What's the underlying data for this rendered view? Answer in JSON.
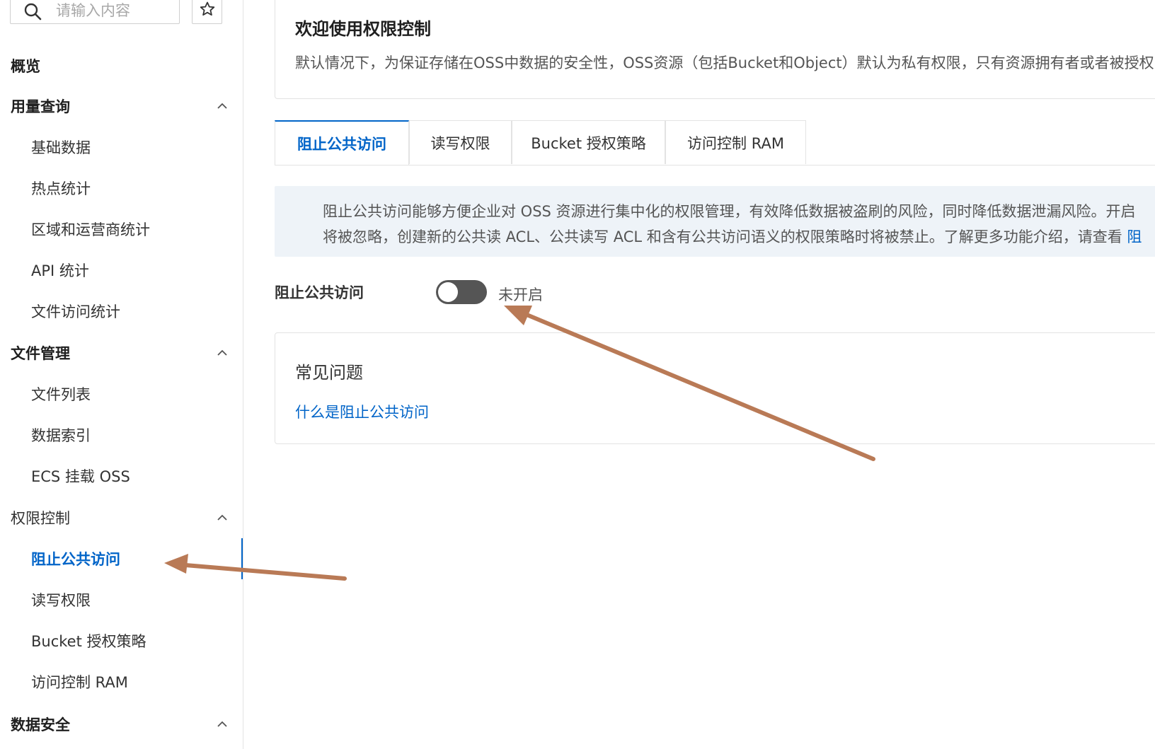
{
  "search": {
    "placeholder": "请输入内容"
  },
  "sidebar": {
    "overview": "概览",
    "usage_group": "用量查询",
    "usage_items": [
      "基础数据",
      "热点统计",
      "区域和运营商统计",
      "API 统计",
      "文件访问统计"
    ],
    "file_group": "文件管理",
    "file_items": [
      "文件列表",
      "数据索引",
      "ECS 挂载 OSS"
    ],
    "perm_group": "权限控制",
    "perm_items": [
      "阻止公共访问",
      "读写权限",
      "Bucket 授权策略",
      "访问控制 RAM"
    ],
    "security_group": "数据安全"
  },
  "intro": {
    "title": "欢迎使用权限控制",
    "desc": "默认情况下，为保证存储在OSS中数据的安全性，OSS资源（包括Bucket和Object）默认为私有权限，只有资源拥有者或者被授权"
  },
  "tabs": [
    "阻止公共访问",
    "读写权限",
    "Bucket 授权策略",
    "访问控制 RAM"
  ],
  "notice": {
    "line1": "阻止公共访问能够方便企业对 OSS 资源进行集中化的权限管理，有效降低数据被盗刷的风险，同时降低数据泄漏风险。开启",
    "line2": "将被忽略，创建新的公共读 ACL、公共读写 ACL 和含有公共访问语义的权限策略时将被禁止。了解更多功能介绍，请查看 ",
    "link": "阻"
  },
  "block_public": {
    "label": "阻止公共访问",
    "status": "未开启",
    "enabled": false
  },
  "faq": {
    "title": "常见问题",
    "link": "什么是阻止公共访问"
  },
  "colors": {
    "accent": "#0064c8",
    "arrow": "#b97a56",
    "notice_bg": "#eef3f8",
    "switch_off": "#555555"
  },
  "icons": {
    "search": "search-icon",
    "favorite": "star-icon",
    "chevron": "chevron-up-icon"
  }
}
